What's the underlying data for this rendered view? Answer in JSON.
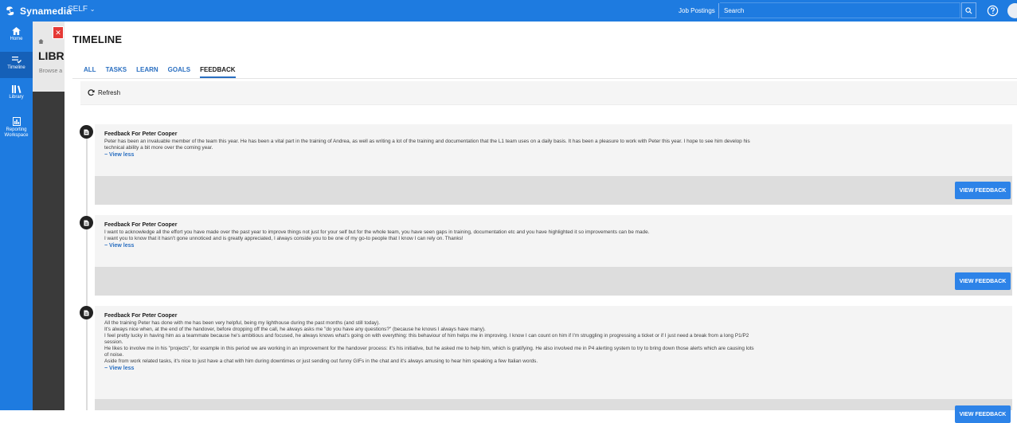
{
  "brand": {
    "name": "Synamedia",
    "org": "SELF",
    "accent": "#1e7be0"
  },
  "topbar": {
    "job_postings": "Job Postings",
    "search_placeholder": "Search"
  },
  "nav": [
    {
      "label": "Home",
      "icon": "home-icon"
    },
    {
      "label": "Timeline",
      "icon": "timeline-icon"
    },
    {
      "label": "Library",
      "icon": "library-icon"
    },
    {
      "label": "Reporting Workspace",
      "icon": "reporting-icon"
    }
  ],
  "background_page": {
    "title": "LIBRA",
    "subtitle": "Browse a"
  },
  "modal": {
    "title": "TIMELINE",
    "tabs": [
      "ALL",
      "TASKS",
      "LEARN",
      "GOALS",
      "FEEDBACK"
    ],
    "active_tab": "FEEDBACK",
    "refresh_label": "Refresh"
  },
  "feedback": [
    {
      "title": "Feedback For Peter Cooper",
      "text": "Peter has been an invaluable member of the team this year. He has been a vital part in the training of Andrea, as well as writing a lot of the training and documentation that the L1 team uses on a daily basis. It has been a pleasure to work with Peter this year. I hope to see him develop his\ntechnical ability a bit more over the coming year.",
      "view_less": "− View less",
      "button": "VIEW FEEDBACK"
    },
    {
      "title": "Feedback For Peter Cooper",
      "text": "I want to acknowledge all the effort you have made over the past year to improve things not just for your self but for the whole team, you have seen gaps in training, documentation etc and you have highlighted it so improvements can be made.\nI want you to know that it hasn't gone unnoticed and is greatly appreciated, I always conside you to be one of my go-to people that I know I can rely on. Thanks!",
      "view_less": "− View less",
      "button": "VIEW FEEDBACK"
    },
    {
      "title": "Feedback For Peter Cooper",
      "text": "All the training Peter has done with me has been very helpful, being my lighthouse during the past months (and still today).\nIt's always nice when, at the end of the handover, before dropping off the call, he always asks me \"do you have any questions?\" (because he knows I always have many).\nI feel pretty lucky in having him as a teammate because he's ambitious and focused, he always knows what's going on with everything: this behaviour of him helps me in improving. I know I can count on him if I'm struggling in progressing a ticket or if I just need a break from a long P1/P2\nsession.\nHe likes to involve me in his \"projects\", for example in this period we are working in an improvement for the handover process: it's his initiative, but he asked me to help him, which is gratifying. He also involved me in P4 alerting system to try to bring down those alerts which are causing lots\nof noise.\nAside from work related tasks, it's nice to just have a chat with him during downtimes or just sending out funny GIFs in the chat and it's always amusing to hear him speaking a few Italian words.",
      "view_less": "− View less",
      "button": "VIEW FEEDBACK"
    }
  ]
}
